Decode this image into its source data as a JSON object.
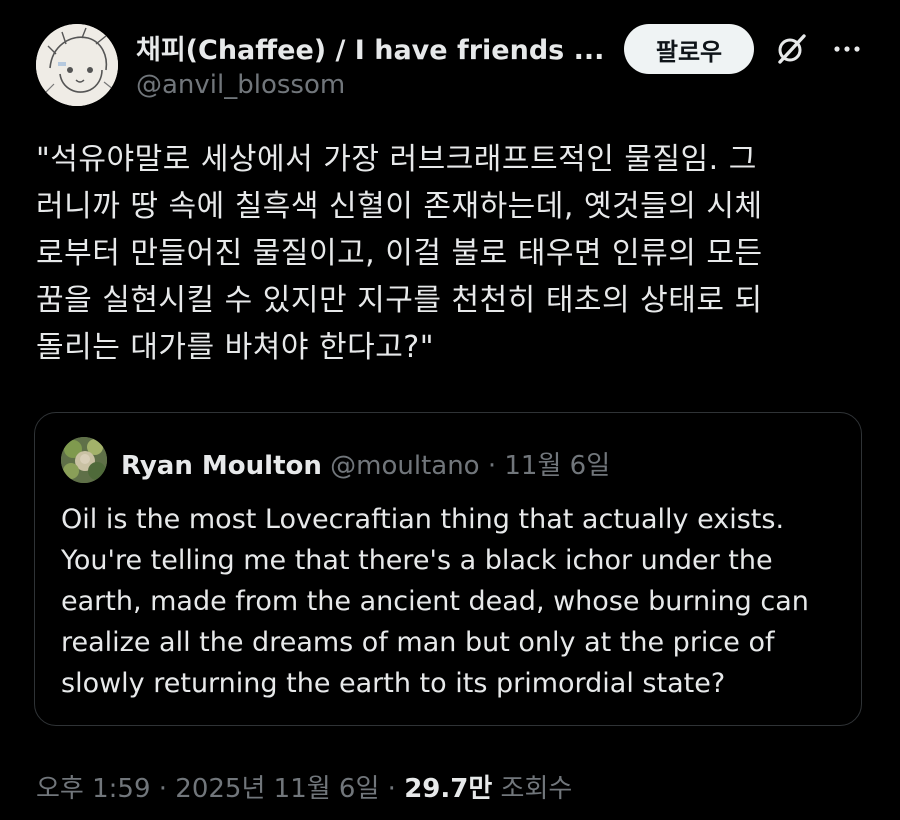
{
  "author": {
    "display_name": "채피(Chaffee) / I have friends ...",
    "handle": "@anvil_blossom",
    "avatar_icon": "sketch-character-avatar"
  },
  "actions": {
    "follow_label": "팔로우",
    "grok_icon": "grok-slash-circle-icon",
    "more_icon": "more-dots-icon"
  },
  "tweet": {
    "text_lines": [
      "\"석유야말로 세상에서 가장 러브크래프트적인 물질임. 그",
      "러니까 땅 속에 칠흑색 신혈이 존재하는데, 옛것들의 시체",
      "로부터 만들어진 물질이고, 이걸 불로 태우면 인류의 모든",
      "꿈을 실현시킬 수 있지만 지구를 천천히 태초의 상태로 되",
      "돌리는 대가를 바쳐야 한다고?\""
    ]
  },
  "quote": {
    "name": "Ryan Moulton",
    "handle": "@moultano",
    "separator": "·",
    "date": "11월 6일",
    "avatar_icon": "green-foliage-avatar",
    "text_lines": [
      "Oil is the most Lovecraftian thing that actually exists.",
      "You're telling me that there's a black ichor under the",
      "earth, made from the ancient dead, whose burning can",
      "realize all the dreams of man but only at the price of",
      "slowly returning the earth to its primordial state?"
    ]
  },
  "footer": {
    "time": "오후 1:59",
    "sep1": "·",
    "date": "2025년 11월 6일",
    "sep2": "·",
    "views_count": "29.7만",
    "views_label": "조회수"
  },
  "colors": {
    "background": "#000000",
    "text": "#e7e9ea",
    "secondary": "#71767b",
    "border": "#2f3336",
    "follow_bg": "#eff3f4"
  }
}
